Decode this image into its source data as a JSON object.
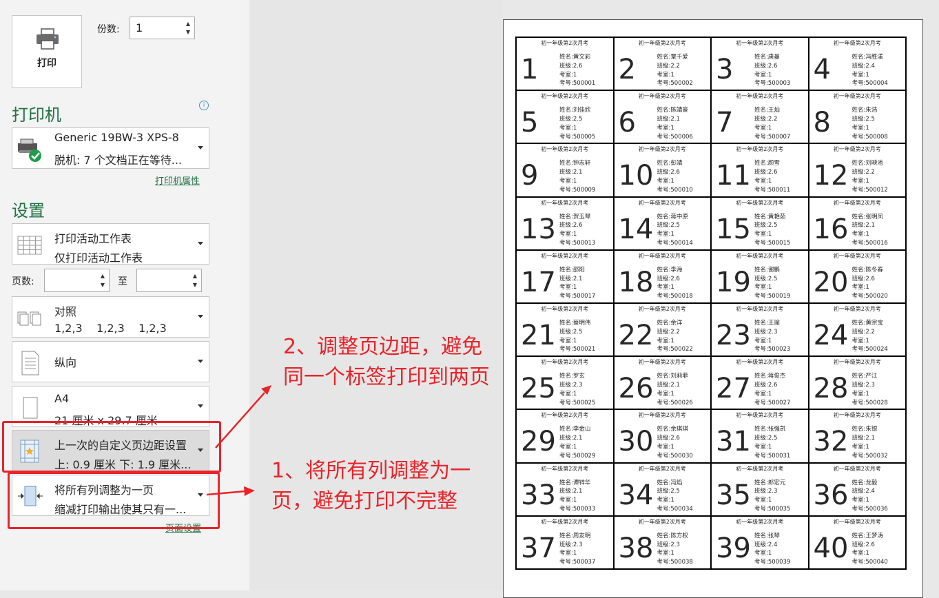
{
  "print_button": {
    "label": "打印"
  },
  "copies": {
    "label": "份数:",
    "value": "1"
  },
  "printer_section": {
    "title": "打印机"
  },
  "printer": {
    "name": "Generic 19BW-3 XPS-8",
    "status": "脱机: 7 个文档正在等待...",
    "properties_link": "打印机属性"
  },
  "settings_section": {
    "title": "设置"
  },
  "settings": {
    "scope": {
      "line1": "打印活动工作表",
      "line2": "仅打印活动工作表"
    },
    "pages": {
      "label": "页数:",
      "to_label": "至",
      "from": "",
      "to": ""
    },
    "collate": {
      "line1": "对照",
      "line2": "1,2,3    1,2,3    1,2,3"
    },
    "orientation": {
      "line1": "纵向"
    },
    "paper": {
      "line1": "A4",
      "line2": "21 厘米 x 29.7 厘米"
    },
    "margins": {
      "line1": "上一次的自定义页边距设置",
      "line2": "上: 0.9 厘米 下: 1.9 厘米..."
    },
    "scaling": {
      "line1": "将所有列调整为一页",
      "line2": "缩减打印输出使其只有一..."
    },
    "page_setup_link": "页面设置"
  },
  "annotations": {
    "note2": "2、调整页边距，避免同一个标签打印到两页",
    "note1": "1、将所有列调整为一页，避免打印不完整"
  },
  "labels_common": {
    "title": "初一年级第2次月考",
    "name_prefix": "姓名:",
    "class_prefix": "班级:",
    "room_prefix": "考室:",
    "id_prefix": "考号:"
  },
  "labels": [
    {
      "n": "1",
      "name": "黄文彩",
      "cls": "2.6",
      "room": "1",
      "id": "500001"
    },
    {
      "n": "2",
      "name": "覃千爱",
      "cls": "2.2",
      "room": "1",
      "id": "500002"
    },
    {
      "n": "3",
      "name": "唐曼",
      "cls": "2.6",
      "room": "1",
      "id": "500003"
    },
    {
      "n": "4",
      "name": "冯胜漾",
      "cls": "2.4",
      "room": "1",
      "id": "500004"
    },
    {
      "n": "5",
      "name": "刘佳欣",
      "cls": "2.5",
      "room": "1",
      "id": "500005"
    },
    {
      "n": "6",
      "name": "陈靖豪",
      "cls": "2.1",
      "room": "1",
      "id": "500006"
    },
    {
      "n": "7",
      "name": "王灿",
      "cls": "2.2",
      "room": "1",
      "id": "500007"
    },
    {
      "n": "8",
      "name": "朱浩",
      "cls": "2.5",
      "room": "1",
      "id": "500008"
    },
    {
      "n": "9",
      "name": "钟志轩",
      "cls": "2.1",
      "room": "1",
      "id": "500009"
    },
    {
      "n": "10",
      "name": "彭靖",
      "cls": "2.6",
      "room": "1",
      "id": "500010"
    },
    {
      "n": "11",
      "name": "颜雪",
      "cls": "2.6",
      "room": "1",
      "id": "500011"
    },
    {
      "n": "12",
      "name": "刘映池",
      "cls": "2.2",
      "room": "1",
      "id": "500012"
    },
    {
      "n": "13",
      "name": "贺玉琴",
      "cls": "2.6",
      "room": "1",
      "id": "500013"
    },
    {
      "n": "14",
      "name": "蒋中原",
      "cls": "2.5",
      "room": "1",
      "id": "500014"
    },
    {
      "n": "15",
      "name": "黄艳茹",
      "cls": "2.5",
      "room": "1",
      "id": "500015"
    },
    {
      "n": "16",
      "name": "张明凤",
      "cls": "2.1",
      "room": "1",
      "id": "500016"
    },
    {
      "n": "17",
      "name": "邵阳",
      "cls": "2.1",
      "room": "1",
      "id": "500017"
    },
    {
      "n": "18",
      "name": "李海",
      "cls": "2.6",
      "room": "1",
      "id": "500018"
    },
    {
      "n": "19",
      "name": "谢鹏",
      "cls": "2.5",
      "room": "1",
      "id": "500019"
    },
    {
      "n": "20",
      "name": "陈冬春",
      "cls": "2.6",
      "room": "1",
      "id": "500020"
    },
    {
      "n": "21",
      "name": "蔡明伟",
      "cls": "2.5",
      "room": "1",
      "id": "500021"
    },
    {
      "n": "22",
      "name": "余洋",
      "cls": "2.2",
      "room": "1",
      "id": "500022"
    },
    {
      "n": "23",
      "name": "王瑜",
      "cls": "2.3",
      "room": "1",
      "id": "500023"
    },
    {
      "n": "24",
      "name": "黄宗宝",
      "cls": "2.2",
      "room": "1",
      "id": "500024"
    },
    {
      "n": "25",
      "name": "罗玄",
      "cls": "2.3",
      "room": "1",
      "id": "500025"
    },
    {
      "n": "26",
      "name": "刘莉菲",
      "cls": "2.1",
      "room": "1",
      "id": "500026"
    },
    {
      "n": "27",
      "name": "蒋俊杰",
      "cls": "2.6",
      "room": "1",
      "id": "500027"
    },
    {
      "n": "28",
      "name": "严江",
      "cls": "2.3",
      "room": "1",
      "id": "500028"
    },
    {
      "n": "29",
      "name": "李金山",
      "cls": "2.1",
      "room": "1",
      "id": "500029"
    },
    {
      "n": "30",
      "name": "余琪琪",
      "cls": "2.6",
      "room": "1",
      "id": "500030"
    },
    {
      "n": "31",
      "name": "张强凯",
      "cls": "2.5",
      "room": "1",
      "id": "500031"
    },
    {
      "n": "32",
      "name": "朱银",
      "cls": "2.1",
      "room": "1",
      "id": "500032"
    },
    {
      "n": "33",
      "name": "谭锌华",
      "cls": "2.1",
      "room": "1",
      "id": "500033"
    },
    {
      "n": "34",
      "name": "冯焰",
      "cls": "2.5",
      "room": "1",
      "id": "500034"
    },
    {
      "n": "35",
      "name": "郎宏元",
      "cls": "2.3",
      "room": "1",
      "id": "500035"
    },
    {
      "n": "36",
      "name": "龙毅",
      "cls": "2.4",
      "room": "1",
      "id": "500036"
    },
    {
      "n": "37",
      "name": "周友明",
      "cls": "2.3",
      "room": "1",
      "id": "500037"
    },
    {
      "n": "38",
      "name": "陈方权",
      "cls": "2.3",
      "room": "1",
      "id": "500038"
    },
    {
      "n": "39",
      "name": "张琴",
      "cls": "2.4",
      "room": "1",
      "id": "500039"
    },
    {
      "n": "40",
      "name": "王梦涛",
      "cls": "2.6",
      "room": "1",
      "id": "500040"
    }
  ]
}
